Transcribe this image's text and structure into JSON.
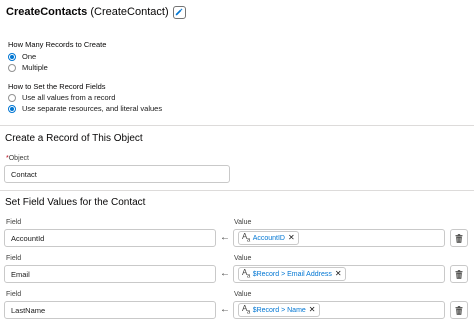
{
  "header": {
    "api_name": "CreateContacts",
    "label": "(CreateContact)"
  },
  "records": {
    "label": "How Many Records to Create",
    "options": [
      {
        "label": "One",
        "checked": true
      },
      {
        "label": "Multiple",
        "checked": false
      }
    ]
  },
  "fields_mode": {
    "label": "How to Set the Record Fields",
    "options": [
      {
        "label": "Use all values from a record",
        "checked": false
      },
      {
        "label": "Use separate resources, and literal values",
        "checked": true
      }
    ]
  },
  "object_section": {
    "heading": "Create a Record of This Object",
    "object_label": "Object",
    "required_marker": "*",
    "object_value": "Contact"
  },
  "field_values_section": {
    "heading": "Set Field Values for the Contact",
    "rows": [
      {
        "field_label": "Field",
        "field": "AccountId",
        "value_label": "Value",
        "value": "AccountID"
      },
      {
        "field_label": "Field",
        "field": "Email",
        "value_label": "Value",
        "value": "$Record > Email Address"
      },
      {
        "field_label": "Field",
        "field": "LastName",
        "value_label": "Value",
        "value": "$Record > Name"
      }
    ]
  },
  "icons": {
    "edit": "pencil-icon",
    "arrow": "left-arrow-icon",
    "text_type": "text-type-icon",
    "close": "close-icon",
    "delete": "trash-icon"
  },
  "colors": {
    "accent": "#0176d3",
    "border": "#c9c9c9",
    "required": "#ba0517"
  }
}
